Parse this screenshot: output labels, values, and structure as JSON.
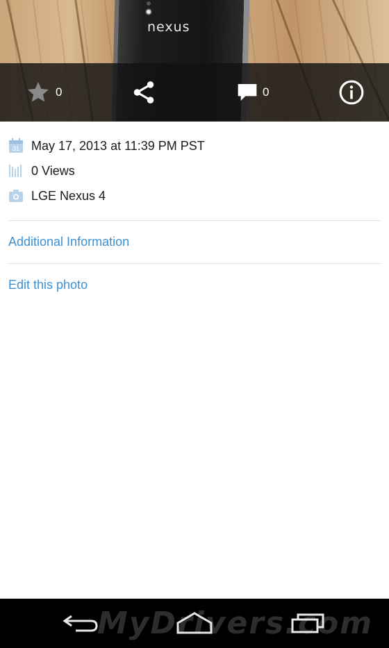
{
  "photo": {
    "brand_text": "nexus"
  },
  "actions": {
    "favorite_count": "0",
    "comment_count": "0",
    "icons": [
      "star-icon",
      "share-icon",
      "comment-icon",
      "info-icon"
    ]
  },
  "details": {
    "date": "May 17, 2013 at 11:39 PM PST",
    "views": "0 Views",
    "camera": "LGE Nexus 4"
  },
  "links": {
    "additional_info": "Additional Information",
    "edit_photo": "Edit this photo"
  },
  "navbar": {
    "watermark": "MyDrivers.com"
  },
  "colors": {
    "link": "#3d8fd0",
    "icon_blue": "#b9d4ea",
    "action_bar": "#121212",
    "navbar": "#000000"
  }
}
